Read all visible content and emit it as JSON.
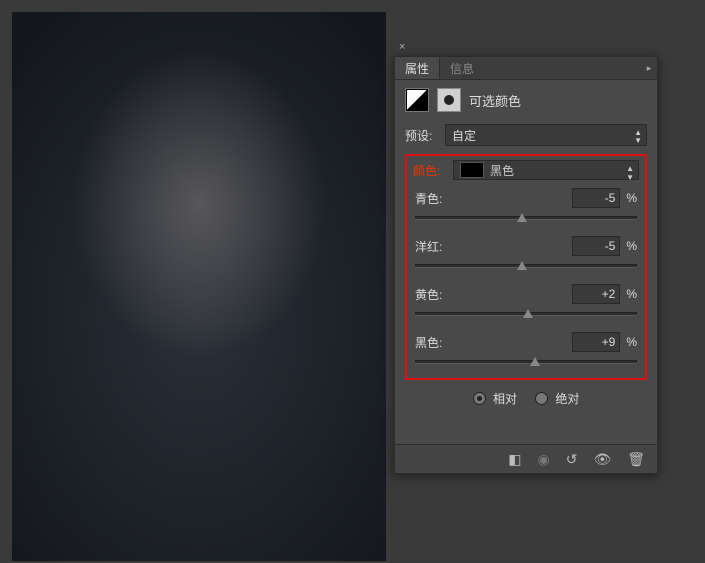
{
  "panel": {
    "tabs": {
      "properties": "属性",
      "info": "信息"
    },
    "title": "可选颜色",
    "preset_label": "预设:",
    "preset_value": "自定",
    "colors_label": "颜色:",
    "colors_value": "黑色",
    "sliders": {
      "cyan": {
        "label": "青色:",
        "value": "-5",
        "pos": 48
      },
      "magenta": {
        "label": "洋红:",
        "value": "-5",
        "pos": 48
      },
      "yellow": {
        "label": "黄色:",
        "value": "+2",
        "pos": 51
      },
      "black": {
        "label": "黑色:",
        "value": "+9",
        "pos": 54
      }
    },
    "percent": "%",
    "method": {
      "relative": "相对",
      "absolute": "绝对"
    }
  },
  "chart_data": {
    "type": "table",
    "title": "可选颜色 — 黑色",
    "rows": [
      {
        "channel": "青色",
        "value_pct": -5
      },
      {
        "channel": "洋红",
        "value_pct": -5
      },
      {
        "channel": "黄色",
        "value_pct": 2
      },
      {
        "channel": "黑色",
        "value_pct": 9
      }
    ],
    "method": "相对",
    "range_pct": [
      -100,
      100
    ]
  }
}
